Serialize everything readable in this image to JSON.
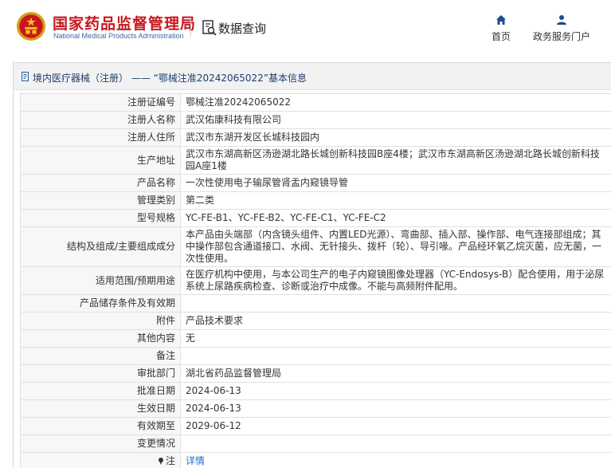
{
  "header": {
    "org_cn": "国家药品监督管理局",
    "org_en": "National Medical Products Administration",
    "query_label": "数据查询",
    "nav": [
      {
        "label": "首页",
        "icon": "home-icon"
      },
      {
        "label": "政务服务门户",
        "icon": "user-icon"
      }
    ]
  },
  "title_bar": {
    "text": "境内医疗器械（注册） —— “鄂械注准20242065022”基本信息",
    "icon": "page-icon"
  },
  "rows": [
    {
      "label": "注册证编号",
      "value": "鄂械注准20242065022"
    },
    {
      "label": "注册人名称",
      "value": "武汉佑康科技有限公司"
    },
    {
      "label": "注册人住所",
      "value": "武汉市东湖开发区长城科技园内"
    },
    {
      "label": "生产地址",
      "value": "武汉市东湖高新区汤逊湖北路长城创新科技园B座4楼；武汉市东湖高新区汤逊湖北路长城创新科技园A座1楼"
    },
    {
      "label": "产品名称",
      "value": "一次性使用电子输尿管肾盂内窥镜导管"
    },
    {
      "label": "管理类别",
      "value": "第二类"
    },
    {
      "label": "型号规格",
      "value": "YC-FE-B1、YC-FE-B2、YC-FE-C1、YC-FE-C2"
    },
    {
      "label": "结构及组成/主要组成成分",
      "value": "本产品由头端部（内含镜头组件、内置LED光源）、弯曲部、插入部、操作部、电气连接部组成；其中操作部包含通道接口、水阀、无针接头、拨杆（轮）、导引喙。产品经环氧乙烷灭菌，应无菌，一次性使用。"
    },
    {
      "label": "适用范围/预期用途",
      "value": "在医疗机构中使用，与本公司生产的电子内窥镜图像处理器（YC-Endosys-B）配合使用，用于泌尿系统上尿路疾病检查、诊断或治疗中成像。不能与高频附件配用。"
    },
    {
      "label": "产品储存条件及有效期",
      "value": ""
    },
    {
      "label": "附件",
      "value": "产品技术要求"
    },
    {
      "label": "其他内容",
      "value": "无"
    },
    {
      "label": "备注",
      "value": ""
    },
    {
      "label": "审批部门",
      "value": "湖北省药品监督管理局"
    },
    {
      "label": "批准日期",
      "value": "2024-06-13"
    },
    {
      "label": "生效日期",
      "value": "2024-06-13"
    },
    {
      "label": "有效期至",
      "value": "2029-06-12"
    },
    {
      "label": "变更情况",
      "value": ""
    }
  ],
  "note_row": {
    "label": "注",
    "link": "详情"
  }
}
